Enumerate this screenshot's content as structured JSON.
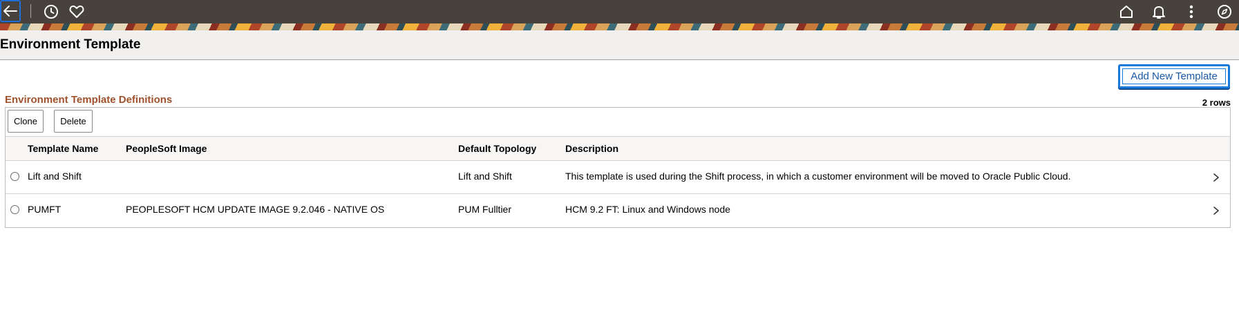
{
  "page": {
    "title": "Environment Template"
  },
  "topbar": {
    "icons": [
      "back-arrow-icon",
      "history-clock-icon",
      "favorites-heart-icon",
      "home-icon",
      "notifications-bell-icon",
      "actions-menu-icon",
      "navbar-compass-icon"
    ]
  },
  "actions": {
    "add_new_template": "Add New Template"
  },
  "grid": {
    "title": "Environment Template Definitions",
    "row_count": "2 rows",
    "toolbar": {
      "clone": "Clone",
      "delete": "Delete"
    },
    "columns": [
      "Template Name",
      "PeopleSoft Image",
      "Default Topology",
      "Description"
    ],
    "rows": [
      {
        "template_name": "Lift and Shift",
        "peoplesoft_image": "",
        "default_topology": "Lift and Shift",
        "description": "This template is used during the Shift process, in which a customer environment will be moved to Oracle Public Cloud."
      },
      {
        "template_name": "PUMFT",
        "peoplesoft_image": "PEOPLESOFT HCM UPDATE IMAGE 9.2.046 - NATIVE OS",
        "default_topology": "PUM Fulltier",
        "description": "HCM 9.2 FT: Linux and Windows node"
      }
    ]
  },
  "colors": {
    "topbar": "#48423c",
    "grid_title": "#a0522d",
    "accent": "#1a7ad9"
  }
}
